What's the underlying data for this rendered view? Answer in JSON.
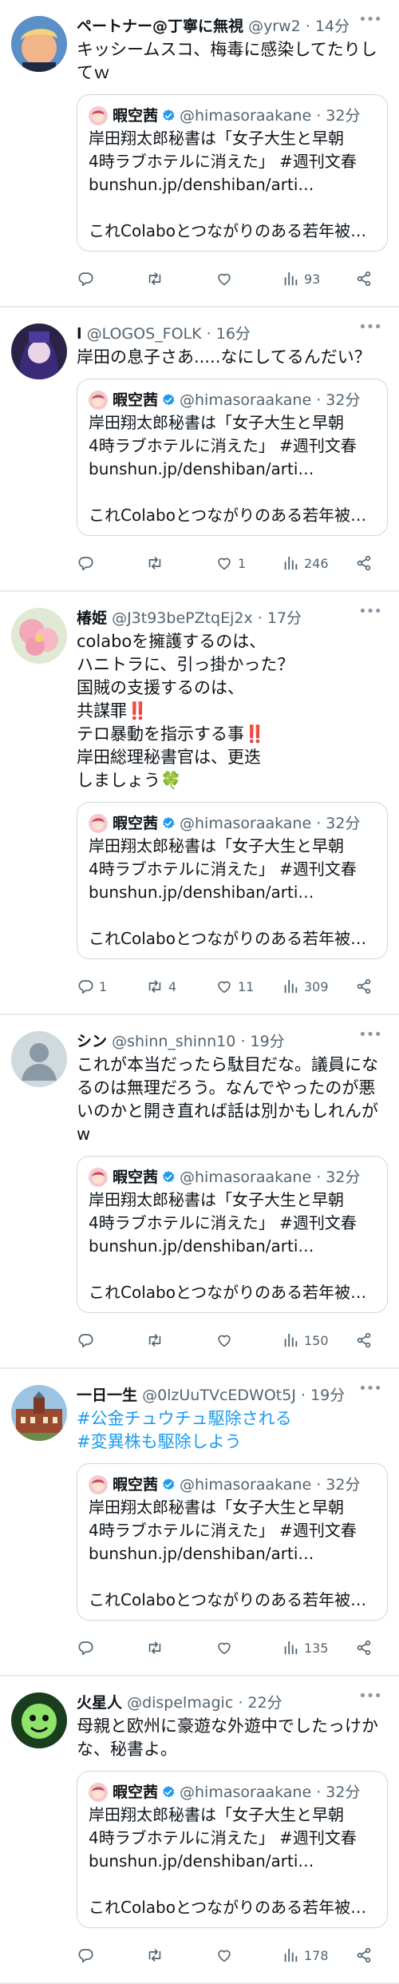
{
  "quote": {
    "name": "暇空茜",
    "handle": "@himasoraakane",
    "time": "32分",
    "lines": [
      "岸田翔太郎秘書は「女子大生と早朝",
      "4時ラブホテルに消えた」 #週刊文春",
      "bunshun.jp/denshiban/arti…"
    ],
    "last_line": "これColaboとつながりのある若年被…"
  },
  "tweets": [
    {
      "name": "ペートナー@丁寧に無視",
      "handle": "@yrw2",
      "time": "14分",
      "text": "キッシームスコ、梅毒に感染してたりしてｗ",
      "reply": "",
      "retweet": "",
      "like": "",
      "views": "93"
    },
    {
      "name": "l",
      "handle": "@LOGOS_FOLK",
      "time": "16分",
      "text": "岸田の息子さあ.....なにしてるんだい？",
      "reply": "",
      "retweet": "",
      "like": "1",
      "views": "246"
    },
    {
      "name": "椿姫",
      "handle": "@J3t93bePZtqEj2x",
      "time": "17分",
      "text": "colaboを擁護するのは、\nハニトラに、引っ掛かった？\n国賊の支援するのは、\n共謀罪‼️\nテロ暴動を指示する事‼️\n岸田総理秘書官は、更迭\nしましょう🍀",
      "reply": "1",
      "retweet": "4",
      "like": "11",
      "views": "309"
    },
    {
      "name": "シン",
      "handle": "@shinn_shinn10",
      "time": "19分",
      "text": "これが本当だったら駄目だな。議員になるのは無理だろう。なんでやったのが悪いのかと開き直れば話は別かもしれんがw",
      "reply": "",
      "retweet": "",
      "like": "",
      "views": "150"
    },
    {
      "name": "一日一生",
      "handle": "@0lzUuTVcEDWOt5J",
      "time": "19分",
      "hashtags": [
        "#公金チュウチュ駆除される",
        "#変異株も駆除しよう"
      ],
      "reply": "",
      "retweet": "",
      "like": "",
      "views": "135"
    },
    {
      "name": "火星人",
      "handle": "@dispelmagic",
      "time": "22分",
      "text": "母親と欧州に豪遊な外遊中でしたっけかな、秘書よ。",
      "reply": "",
      "retweet": "",
      "like": "",
      "views": "178"
    }
  ]
}
